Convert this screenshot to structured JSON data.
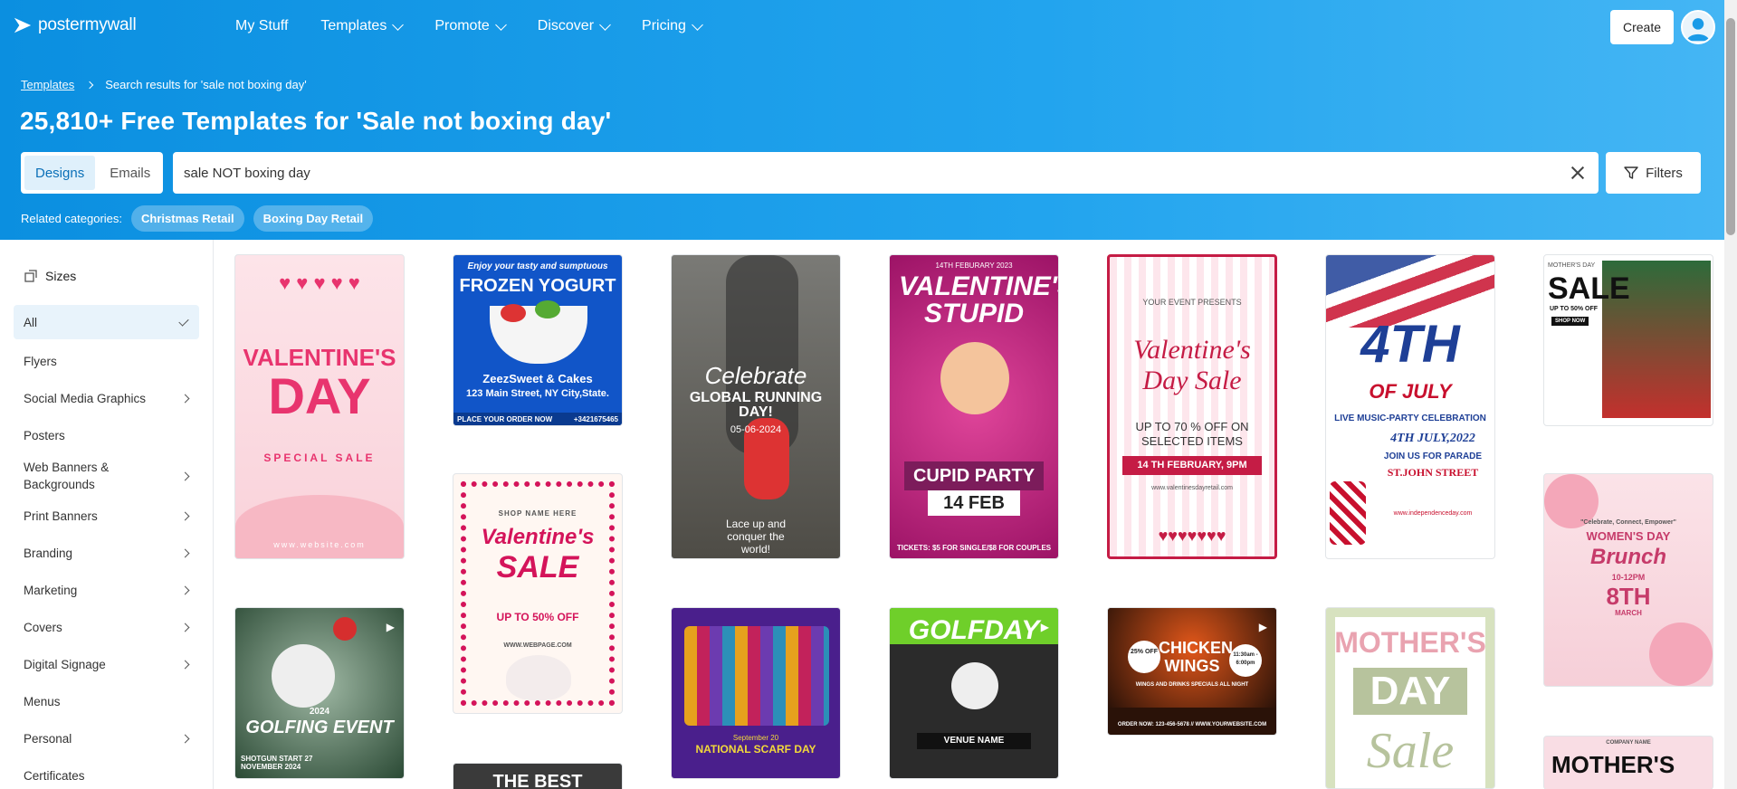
{
  "header": {
    "logo_text": "postermywall",
    "nav": [
      "My Stuff",
      "Templates",
      "Promote",
      "Discover",
      "Pricing"
    ],
    "create_label": "Create"
  },
  "breadcrumb": {
    "root": "Templates",
    "current": "Search results for 'sale not boxing day'"
  },
  "page_title": "25,810+ Free Templates for 'Sale not boxing day'",
  "tabs": {
    "designs": "Designs",
    "emails": "Emails"
  },
  "search": {
    "value": "sale NOT boxing day"
  },
  "filters_label": "Filters",
  "related": {
    "label": "Related categories:",
    "chips": [
      "Christmas Retail",
      "Boxing Day Retail"
    ]
  },
  "sidebar": {
    "heading": "Sizes",
    "items": [
      {
        "label": "All",
        "active": true
      },
      {
        "label": "Flyers"
      },
      {
        "label": "Social Media Graphics",
        "arrow": true
      },
      {
        "label": "Posters"
      },
      {
        "label": "Web Banners & Backgrounds",
        "arrow": true
      },
      {
        "label": "Print Banners",
        "arrow": true
      },
      {
        "label": "Branding",
        "arrow": true
      },
      {
        "label": "Marketing",
        "arrow": true
      },
      {
        "label": "Covers",
        "arrow": true
      },
      {
        "label": "Digital Signage",
        "arrow": true
      },
      {
        "label": "Menus"
      },
      {
        "label": "Personal",
        "arrow": true
      },
      {
        "label": "Certificates"
      }
    ]
  },
  "templates": [
    {
      "t1": "VALENTINE'S",
      "t2": "DAY",
      "t3": "SPECIAL SALE",
      "t4": "www.website.com",
      "bg": "#fde1e6",
      "fg": "#e8346e"
    },
    {
      "t1": "Enjoy your tasty and sumptuous",
      "t2": "FROZEN YOGURT",
      "t3": "ZeezSweet & Cakes",
      "t4": "123 Main Street, NY City,State.",
      "t5": "PLACE YOUR ORDER NOW",
      "t6": "+3421675465",
      "bg": "#1155c8",
      "fg": "#ffffff"
    },
    {
      "t1": "Celebrate",
      "t2": "GLOBAL RUNNING DAY!",
      "t3": "05-06-2024",
      "t4": "Lace up and conquer the world!",
      "bg": "#6c6c68",
      "fg": "#ffffff"
    },
    {
      "t1": "14TH FEBURARY 2023",
      "t2": "VALENTINE'S STUPID",
      "t3": "CUPID PARTY",
      "t4": "14 FEB",
      "t5": "TICKETS: $5 FOR SINGLE/$8 FOR COUPLES",
      "bg": "#c2227e",
      "fg": "#ffffff"
    },
    {
      "t1": "YOUR EVENT PRESENTS",
      "t2": "Valentine's Day Sale",
      "t3": "UP TO 70 % OFF ON SELECTED ITEMS",
      "t4": "14 TH FEBRUARY, 9PM",
      "t5": "www.valentinesdayretail.com",
      "bg": "#fce8ee",
      "fg": "#c51c45"
    },
    {
      "t1": "4TH",
      "t2": "OF JULY",
      "t3": "LIVE MUSIC-PARTY CELEBRATION",
      "t4": "4TH JULY,2022",
      "t5": "JOIN US FOR PARADE",
      "t6": "ST.JOHN STREET",
      "t7": "www.independenceday.com",
      "bg": "#ffffff",
      "fg": "#1e3f96"
    },
    {
      "t1": "MOTHER'S DAY",
      "t2": "SALE",
      "t3": "UP TO 50% OFF",
      "t4": "SHOP NOW",
      "bg": "#ffffff",
      "fg": "#111111"
    },
    {
      "t1": "SHOP NAME HERE",
      "t2": "Valentine's",
      "t3": "SALE",
      "t4": "UP TO 50% OFF",
      "t5": "WWW.WEBPAGE.COM",
      "bg": "#fff7f2",
      "fg": "#d4145a"
    },
    {
      "t1": "\"Celebrate, Connect, Empower\"",
      "t2": "WOMEN'S DAY",
      "t3": "Brunch",
      "t4": "10-12PM",
      "t5": "8TH",
      "t6": "MARCH",
      "bg": "#fbe3e8",
      "fg": "#c63b6a"
    },
    {
      "t1": "2024",
      "t2": "GOLFING EVENT",
      "t3": "SHOTGUN START 27 NOVEMBER 2024",
      "bg": "#2f4f3a",
      "fg": "#ffffff"
    },
    {
      "t1": "THE BEST",
      "bg": "#333333",
      "fg": "#ffffff"
    },
    {
      "t1": "NATIONAL SCARF DAY",
      "t2": "September 20",
      "bg": "#4a1f8c",
      "fg": "#f3d93a"
    },
    {
      "t1": "GOLFDAY",
      "t2": "VENUE NAME",
      "bg": "#6fcf2a",
      "fg": "#ffffff"
    },
    {
      "t1": "CHICKEN WINGS",
      "t2": "WINGS AND DRINKS SPECIALS ALL NIGHT",
      "t3": "ORDER NOW: 123-456-5678 // WWW.YOURWEBSITE.COM",
      "t4": "25% OFF",
      "t5": "11:30am - 6:00pm",
      "bg": "#2a1208",
      "fg": "#ffffff"
    },
    {
      "t1": "MOTHER'S",
      "t2": "DAY",
      "t3": "Sale",
      "bg": "#d7e2bf",
      "fg": "#ffffff"
    },
    {
      "t1": "MOTHER'S",
      "t2": "COMPANY NAME",
      "bg": "#f9dde4",
      "fg": "#111111"
    }
  ],
  "colors": {
    "primary": "#1a9be8",
    "accent_bg": "#e8f3fb"
  }
}
